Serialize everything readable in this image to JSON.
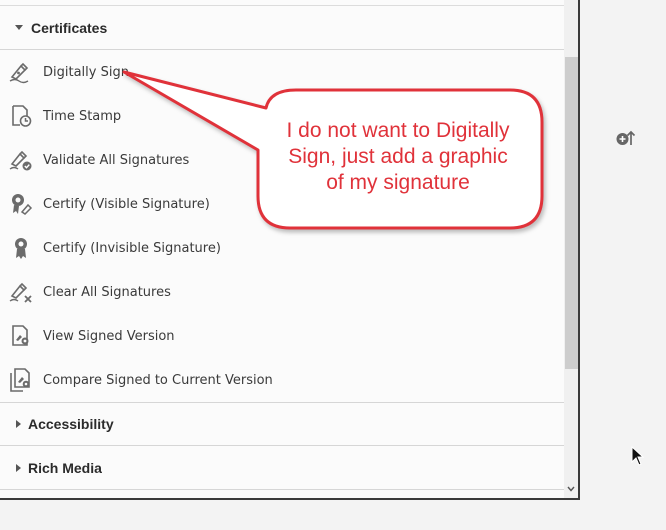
{
  "sections": {
    "certificates": {
      "label": "Certificates",
      "expanded": true
    },
    "accessibility": {
      "label": "Accessibility",
      "expanded": false
    },
    "rich_media": {
      "label": "Rich Media",
      "expanded": false
    }
  },
  "tools": [
    {
      "label": "Digitally Sign",
      "icon": "pen-sign-icon"
    },
    {
      "label": "Time Stamp",
      "icon": "document-clock-icon"
    },
    {
      "label": "Validate All Signatures",
      "icon": "pen-check-icon"
    },
    {
      "label": "Certify (Visible Signature)",
      "icon": "ribbon-pen-icon"
    },
    {
      "label": "Certify (Invisible Signature)",
      "icon": "ribbon-icon"
    },
    {
      "label": "Clear All Signatures",
      "icon": "pen-clear-icon"
    },
    {
      "label": "View Signed Version",
      "icon": "document-signed-icon"
    },
    {
      "label": "Compare Signed to Current Version",
      "icon": "documents-compare-icon"
    }
  ],
  "callout": {
    "lines": [
      "I do not want to Digitally",
      "Sign, just add a graphic",
      "of my signature"
    ],
    "color": "#e0323a"
  },
  "colors": {
    "panel_bg": "#fbfbfb",
    "icon_gray": "#6b6b6b",
    "callout_fill": "#ffffff",
    "callout_stroke": "#e0323a"
  }
}
